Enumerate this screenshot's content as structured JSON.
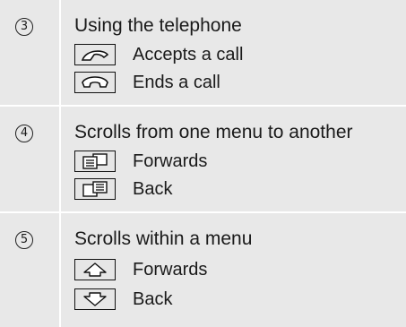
{
  "sections": [
    {
      "number": "3",
      "heading": "Using the telephone",
      "items": [
        {
          "icon": "phone-accept-icon",
          "label": "Accepts a call"
        },
        {
          "icon": "phone-end-icon",
          "label": "Ends a call"
        }
      ]
    },
    {
      "number": "4",
      "heading": "Scrolls from one menu to another",
      "items": [
        {
          "icon": "menu-forward-icon",
          "label": "Forwards"
        },
        {
          "icon": "menu-back-icon",
          "label": "Back"
        }
      ]
    },
    {
      "number": "5",
      "heading": "Scrolls within a menu",
      "items": [
        {
          "icon": "arrow-up-icon",
          "label": "Forwards"
        },
        {
          "icon": "arrow-down-icon",
          "label": "Back"
        }
      ]
    }
  ],
  "colors": {
    "row_background": "#e8e8e8",
    "text": "#1a1a1a",
    "border": "#111111"
  }
}
